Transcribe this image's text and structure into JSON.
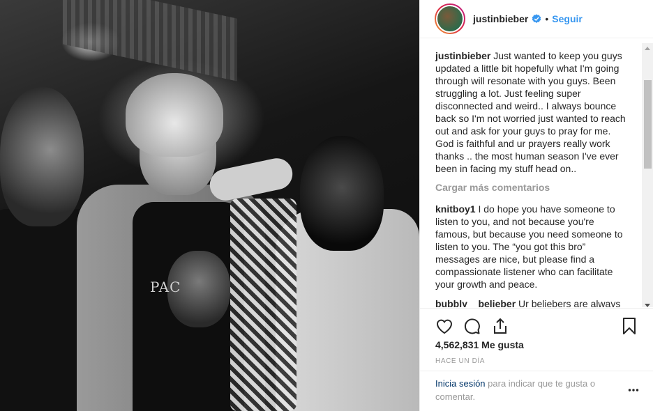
{
  "post": {
    "username": "justinbieber",
    "follow_label": "Seguir",
    "separator": "•"
  },
  "comments": [
    {
      "user": "justinbieber",
      "text": "Just wanted to keep you guys updated a little bit hopefully what I'm going through will resonate with you guys. Been struggling a lot. Just feeling super disconnected and weird.. I always bounce back so I'm not worried just wanted to reach out and ask for your guys to pray for me. God is faithful and ur prayers really work thanks .. the most human season I've ever been in facing my stuff head on.."
    },
    {
      "user": "knitboy1",
      "text": "I do hope you have someone to listen to you, and not because you're famous, but because you need someone to listen to you. The “you got this bro” messages are nice, but please find a compassionate listener who can facilitate your growth and peace."
    },
    {
      "user": "bubbly__belieber",
      "text": "Ur beliebers are always"
    }
  ],
  "load_more": "Cargar más comentarios",
  "likes": "4,562,831 Me gusta",
  "time_ago": "HACE UN DÍA",
  "login_prompt": {
    "link": "Inicia sesión",
    "rest": " para indicar que te gusta o comentar."
  },
  "photo": {
    "shirt_text": "PAC"
  },
  "icons": [
    "verified-badge-icon",
    "heart-icon",
    "comment-icon",
    "share-icon",
    "bookmark-icon",
    "more-options-icon"
  ],
  "colors": {
    "link_blue": "#3897f0",
    "text": "#262626",
    "muted": "#999999",
    "login_link": "#003569"
  }
}
